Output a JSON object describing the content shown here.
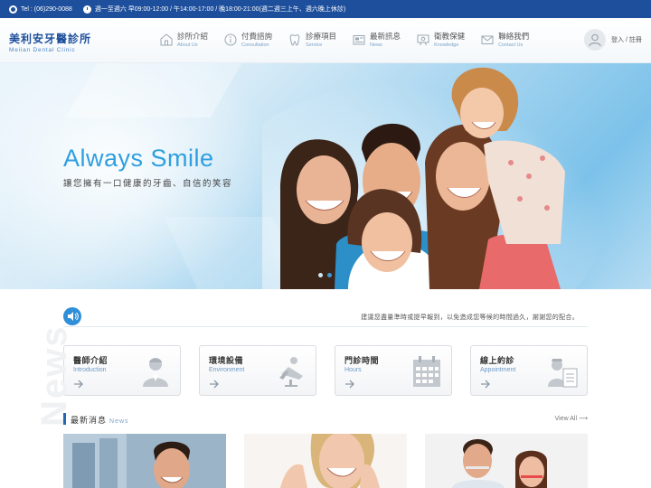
{
  "topbar": {
    "phone": "Tel : (06)290-0088",
    "hours": "週一至週六 早09:00-12:00 / 午14:00-17:00 / 晚18:00-21:00(週二週三上午、週六晚上休診)"
  },
  "brand": {
    "name_zh": "美利安牙醫診所",
    "name_en": "Meiian Dental Clinic"
  },
  "nav": [
    {
      "zh": "診所介紹",
      "en": "About Us",
      "icon": "clinic-icon"
    },
    {
      "zh": "付費諮詢",
      "en": "Consultation",
      "icon": "info-icon"
    },
    {
      "zh": "診療項目",
      "en": "Service",
      "icon": "tooth-icon"
    },
    {
      "zh": "最新訊息",
      "en": "News",
      "icon": "newspaper-icon"
    },
    {
      "zh": "衛教保健",
      "en": "Knowledge",
      "icon": "presentation-icon"
    },
    {
      "zh": "聯絡我們",
      "en": "Contact Us",
      "icon": "mail-icon"
    }
  ],
  "user": {
    "login_label": "登入 / 註冊"
  },
  "hero": {
    "title": "Always Smile",
    "subtitle": "讓您擁有一口健康的牙齒、自信的笑容",
    "slides": 2,
    "active_slide": 2
  },
  "notice": {
    "text": "建議您盡量準時或提早報到，以免造成您等候的時間過久，謝謝您的配合。"
  },
  "cards": [
    {
      "zh": "醫師介紹",
      "en": "Introduction",
      "icon": "doctor-icon"
    },
    {
      "zh": "環境設備",
      "en": "Environment",
      "icon": "dental-chair-icon"
    },
    {
      "zh": "門診時間",
      "en": "Hours",
      "icon": "calendar-icon"
    },
    {
      "zh": "線上約診",
      "en": "Appointment",
      "icon": "nurse-clipboard-icon"
    }
  ],
  "news": {
    "title": "最新消息",
    "subtitle": "News",
    "more": "View All"
  },
  "colors": {
    "primary": "#1e4f9c",
    "accent": "#2e9fe0",
    "link": "#6b99c4"
  }
}
